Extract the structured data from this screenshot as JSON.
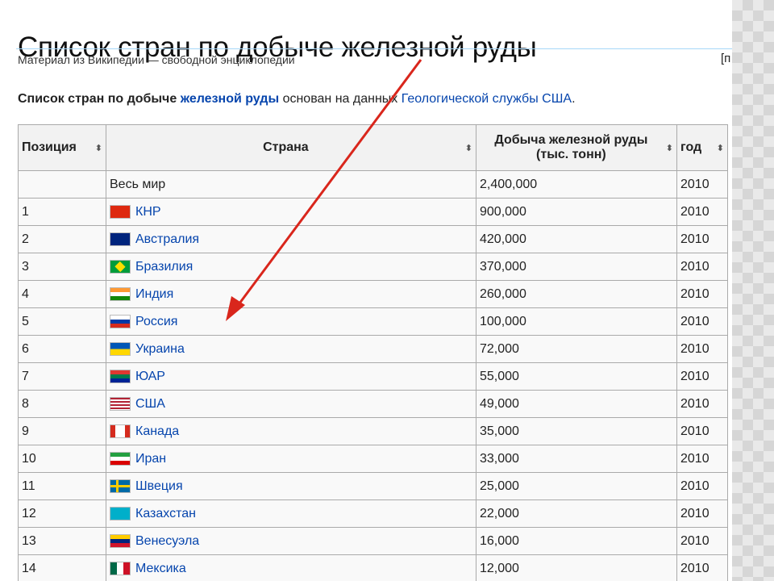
{
  "page": {
    "title": "Список стран по добыче железной руды",
    "subtitle": "Материал из Википедии — свободной энциклопедии",
    "edit_fragment": "[п"
  },
  "intro": {
    "bold": "Список стран по добыче ",
    "link1": "железной руды",
    "middle": " основан на данных ",
    "link2": "Геологической службы США",
    "end": "."
  },
  "table": {
    "headers": {
      "position": "Позиция",
      "country": "Страна",
      "production_line1": "Добыча железной руды",
      "production_line2": "(тыс. тонн)",
      "year": "год"
    },
    "sort_icon": "sort-arrows-icon",
    "rows": [
      {
        "pos": "",
        "country": "Весь мир",
        "flag": "",
        "value": "2,400,000",
        "year": "2010"
      },
      {
        "pos": "1",
        "country": "КНР",
        "flag": "cn",
        "value": "900,000",
        "year": "2010"
      },
      {
        "pos": "2",
        "country": "Австралия",
        "flag": "au",
        "value": "420,000",
        "year": "2010"
      },
      {
        "pos": "3",
        "country": "Бразилия",
        "flag": "br",
        "value": "370,000",
        "year": "2010"
      },
      {
        "pos": "4",
        "country": "Индия",
        "flag": "in",
        "value": "260,000",
        "year": "2010"
      },
      {
        "pos": "5",
        "country": "Россия",
        "flag": "ru",
        "value": "100,000",
        "year": "2010"
      },
      {
        "pos": "6",
        "country": "Украина",
        "flag": "ua",
        "value": "72,000",
        "year": "2010"
      },
      {
        "pos": "7",
        "country": "ЮАР",
        "flag": "za",
        "value": "55,000",
        "year": "2010"
      },
      {
        "pos": "8",
        "country": "США",
        "flag": "us",
        "value": "49,000",
        "year": "2010"
      },
      {
        "pos": "9",
        "country": "Канада",
        "flag": "ca",
        "value": "35,000",
        "year": "2010"
      },
      {
        "pos": "10",
        "country": "Иран",
        "flag": "ir",
        "value": "33,000",
        "year": "2010"
      },
      {
        "pos": "11",
        "country": "Швеция",
        "flag": "se",
        "value": "25,000",
        "year": "2010"
      },
      {
        "pos": "12",
        "country": "Казахстан",
        "flag": "kz",
        "value": "22,000",
        "year": "2010"
      },
      {
        "pos": "13",
        "country": "Венесуэла",
        "flag": "ve",
        "value": "16,000",
        "year": "2010"
      },
      {
        "pos": "14",
        "country": "Мексика",
        "flag": "mx",
        "value": "12,000",
        "year": "2010"
      }
    ]
  },
  "annotation": {
    "arrow_color": "#d9261c"
  }
}
